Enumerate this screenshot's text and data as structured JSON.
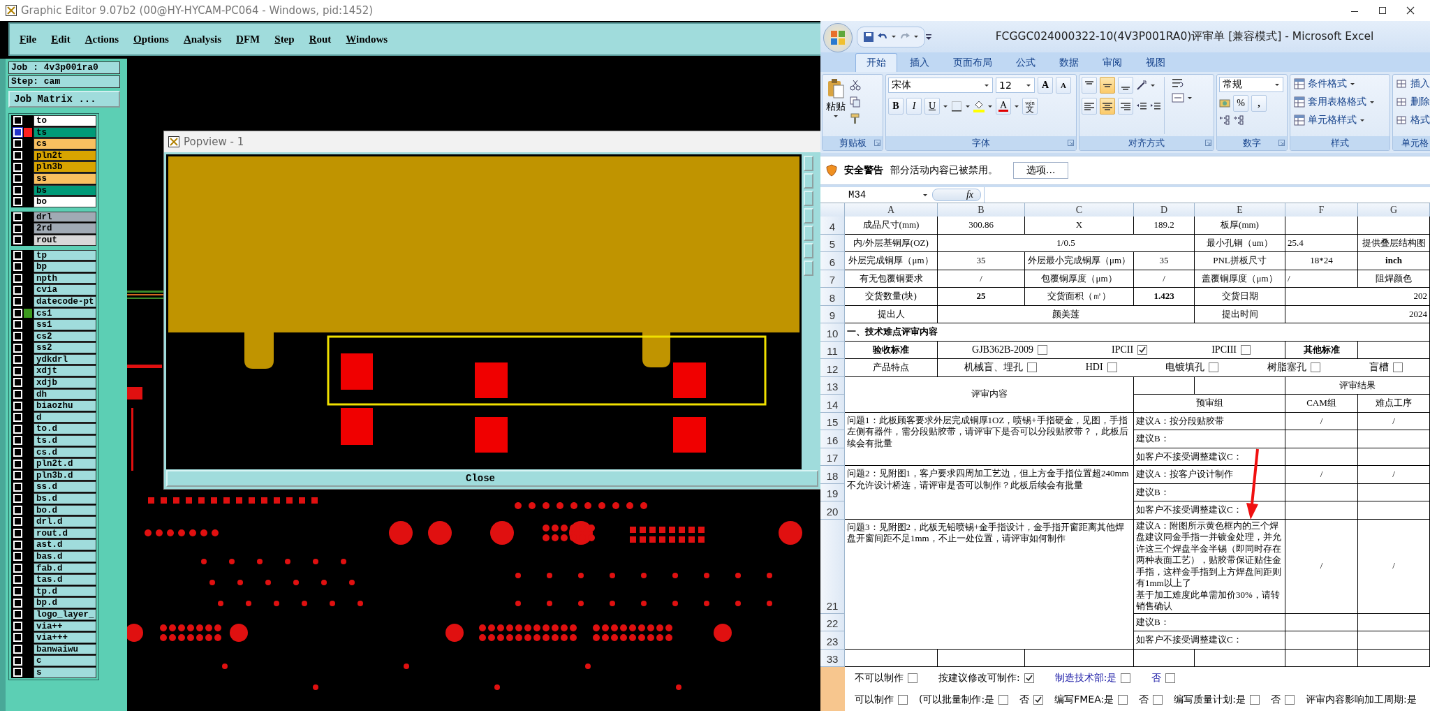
{
  "editor": {
    "title": "Graphic Editor 9.07b2 (00@HY-HYCAM-PC064 - Windows, pid:1452)",
    "menu": [
      "File",
      "Edit",
      "Actions",
      "Options",
      "Analysis",
      "DFM",
      "Step",
      "Rout",
      "Windows"
    ],
    "job": "Job : 4v3p001ra0",
    "step": "Step: cam",
    "job_matrix_button": "Job Matrix ...",
    "layer_groups": [
      [
        {
          "name": "to",
          "color": "#ffffff",
          "selected": false
        },
        {
          "name": "ts",
          "color": "#009a78",
          "selected": true,
          "marker": {
            "color": "#ff2020"
          }
        },
        {
          "name": "cs",
          "color": "#f8c060",
          "selected": false
        },
        {
          "name": "pln2t",
          "color": "#d8a400",
          "selected": false
        },
        {
          "name": "pln3b",
          "color": "#d8a400",
          "selected": false
        },
        {
          "name": "ss",
          "color": "#f8c060",
          "selected": false
        },
        {
          "name": "bs",
          "color": "#009a78",
          "selected": false
        },
        {
          "name": "bo",
          "color": "#ffffff",
          "selected": false
        }
      ],
      [
        {
          "name": "drl",
          "color": "#a0aab4",
          "selected": false
        },
        {
          "name": "2rd",
          "color": "#a0aab4",
          "selected": false
        },
        {
          "name": "rout",
          "color": "#d8d8d8",
          "selected": false
        }
      ],
      [
        {
          "name": "tp",
          "color": "#a0dcdc",
          "selected": false
        },
        {
          "name": "bp",
          "color": "#a0dcdc",
          "selected": false
        },
        {
          "name": "npth",
          "color": "#a0dcdc",
          "selected": false
        },
        {
          "name": "cvia",
          "color": "#a0dcdc",
          "selected": false
        },
        {
          "name": "datecode-pt",
          "color": "#a0dcdc",
          "selected": false
        },
        {
          "name": "cs1",
          "color": "#a0dcdc",
          "selected": false,
          "marker": {
            "color": "#3c9a1e"
          }
        },
        {
          "name": "ss1",
          "color": "#a0dcdc",
          "selected": false
        },
        {
          "name": "cs2",
          "color": "#a0dcdc",
          "selected": false
        },
        {
          "name": "ss2",
          "color": "#a0dcdc",
          "selected": false
        },
        {
          "name": "ydkdrl",
          "color": "#a0dcdc",
          "selected": false
        },
        {
          "name": "xdjt",
          "color": "#a0dcdc",
          "selected": false
        },
        {
          "name": "xdjb",
          "color": "#a0dcdc",
          "selected": false
        },
        {
          "name": "dh",
          "color": "#a0dcdc",
          "selected": false
        },
        {
          "name": "biaozhu",
          "color": "#a0dcdc",
          "selected": false
        },
        {
          "name": "d",
          "color": "#a0dcdc",
          "selected": false
        },
        {
          "name": "to.d",
          "color": "#a0dcdc",
          "selected": false
        },
        {
          "name": "ts.d",
          "color": "#a0dcdc",
          "selected": false
        },
        {
          "name": "cs.d",
          "color": "#a0dcdc",
          "selected": false
        },
        {
          "name": "pln2t.d",
          "color": "#a0dcdc",
          "selected": false
        },
        {
          "name": "pln3b.d",
          "color": "#a0dcdc",
          "selected": false
        },
        {
          "name": "ss.d",
          "color": "#a0dcdc",
          "selected": false
        },
        {
          "name": "bs.d",
          "color": "#a0dcdc",
          "selected": false
        },
        {
          "name": "bo.d",
          "color": "#a0dcdc",
          "selected": false
        },
        {
          "name": "drl.d",
          "color": "#a0dcdc",
          "selected": false
        },
        {
          "name": "rout.d",
          "color": "#a0dcdc",
          "selected": false
        },
        {
          "name": "ast.d",
          "color": "#a0dcdc",
          "selected": false
        },
        {
          "name": "bas.d",
          "color": "#a0dcdc",
          "selected": false
        },
        {
          "name": "fab.d",
          "color": "#a0dcdc",
          "selected": false
        },
        {
          "name": "tas.d",
          "color": "#a0dcdc",
          "selected": false
        },
        {
          "name": "tp.d",
          "color": "#a0dcdc",
          "selected": false
        },
        {
          "name": "bp.d",
          "color": "#a0dcdc",
          "selected": false
        },
        {
          "name": "logo_layer_",
          "color": "#a0dcdc",
          "selected": false
        },
        {
          "name": "via++",
          "color": "#a0dcdc",
          "selected": false
        },
        {
          "name": "via+++",
          "color": "#a0dcdc",
          "selected": false
        },
        {
          "name": "banwaiwu",
          "color": "#a0dcdc",
          "selected": false
        },
        {
          "name": "c",
          "color": "#a0dcdc",
          "selected": false
        },
        {
          "name": "s",
          "color": "#a0dcdc",
          "selected": false
        }
      ]
    ],
    "popview": {
      "title": "Popview - 1",
      "close_button": "Close"
    }
  },
  "excel": {
    "title": "FCGGC024000322-10(4V3P001RA0)评审单  [兼容模式] - Microsoft Excel",
    "tabs": [
      {
        "label": "开始",
        "selected": true
      },
      {
        "label": "插入",
        "selected": false
      },
      {
        "label": "页面布局",
        "selected": false
      },
      {
        "label": "公式",
        "selected": false
      },
      {
        "label": "数据",
        "selected": false
      },
      {
        "label": "审阅",
        "selected": false
      },
      {
        "label": "视图",
        "selected": false
      }
    ],
    "ribbon": {
      "clipboard": {
        "paste": "粘贴",
        "label": "剪贴板"
      },
      "font": {
        "name": "宋体",
        "size": "12",
        "grow": "A",
        "shrink": "A",
        "bold": "B",
        "italic": "I",
        "underline": "U",
        "font_color": "A",
        "phonetic_top": "wén",
        "phonetic_bottom": "文",
        "label": "字体"
      },
      "alignment": {
        "label": "对齐方式",
        "vertical": [
          {
            "selected": false
          },
          {
            "selected": true
          },
          {
            "selected": false
          }
        ],
        "horizontal": [
          {
            "selected": false
          },
          {
            "selected": true
          },
          {
            "selected": false
          }
        ]
      },
      "number": {
        "format": "常规",
        "percent": "%",
        "comma": ",",
        "label": "数字"
      },
      "styles": {
        "items": [
          "条件格式",
          "套用表格格式",
          "单元格样式"
        ],
        "label": "样式"
      },
      "cells": {
        "items": [
          "插入",
          "删除",
          "格式"
        ],
        "label": "单元格"
      }
    },
    "security": {
      "title": "安全警告",
      "message": "部分活动内容已被禁用。",
      "button": "选项..."
    },
    "name_box": "M34",
    "formula_label": "fx",
    "columns": [
      "A",
      "B",
      "C",
      "D",
      "E",
      "F",
      "G"
    ],
    "row_numbers": [
      "4",
      "5",
      "6",
      "7",
      "8",
      "9",
      "10",
      "11",
      "12",
      "13",
      "14",
      "15",
      "16",
      "17",
      "18",
      "19",
      "20",
      "21",
      "22",
      "23",
      "33"
    ],
    "cells": [
      {
        "text": "成品尺寸(mm)"
      },
      {
        "text": "300.86"
      },
      {
        "text": "X"
      },
      {
        "text": "189.2"
      },
      {
        "text": "板厚(mm)"
      },
      {
        "text": "内/外层基铜厚(OZ)"
      },
      {
        "text": "1/0.5"
      },
      {
        "text": "最小孔铜（um）"
      },
      {
        "text": "25.4"
      },
      {
        "text": "提供叠层结构图"
      },
      {
        "text": "外层完成铜厚（μm）"
      },
      {
        "text": "35"
      },
      {
        "text": "外层最小完成铜厚（μm）"
      },
      {
        "text": "35"
      },
      {
        "text": "PNL拼板尺寸"
      },
      {
        "text": "18*24"
      },
      {
        "text": "inch",
        "bold": true
      },
      {
        "text": "有无包覆铜要求"
      },
      {
        "text": "/"
      },
      {
        "text": "包覆铜厚度（μm）"
      },
      {
        "text": "/"
      },
      {
        "text": "盖覆铜厚度（μm）"
      },
      {
        "text": "/"
      },
      {
        "text": "阻焊颜色"
      },
      {
        "text": "交货数量(块)"
      },
      {
        "text": "25",
        "bold": true
      },
      {
        "text": "交货面积（㎡）"
      },
      {
        "text": "1.423",
        "bold": true
      },
      {
        "text": "交货日期"
      },
      {
        "text": "202"
      },
      {
        "text": "提出人"
      },
      {
        "text": "颜美莲"
      },
      {
        "text": "提出时间"
      },
      {
        "text": "2024"
      },
      {
        "text": "一、技术难点评审内容",
        "bold": true
      },
      {
        "text": "验收标准",
        "bold": true
      },
      {
        "options": [
          {
            "label": "GJB362B-2009",
            "checked": false
          },
          {
            "label": "IPCII",
            "checked": true
          },
          {
            "label": "IPCIII",
            "checked": false
          }
        ]
      },
      {
        "text": "其他标准",
        "bold": true
      },
      {
        "text": "产品特点"
      },
      {
        "options": [
          {
            "label": "机械盲、埋孔",
            "checked": false
          },
          {
            "label": "HDI",
            "checked": false
          },
          {
            "label": "电镀填孔",
            "checked": false
          },
          {
            "label": "树脂塞孔",
            "checked": false
          },
          {
            "label": "盲槽",
            "checked": false
          }
        ]
      },
      {
        "text": "评审内容"
      },
      {
        "text": "评审结果"
      },
      {
        "text": "预审组"
      },
      {
        "text": "CAM组"
      },
      {
        "text": "难点工序"
      },
      {
        "text": "问题1：此板顾客要求外层完成铜厚1OZ，喷锡+手指硬金，见图，手指左侧有器件，需分段贴胶带，请评审下是否可以分段贴胶带？，此板后续会有批量"
      },
      {
        "text": "建议A：按分段贴胶带"
      },
      {
        "text": "/"
      },
      {
        "text": "/"
      },
      {
        "text": "建议B："
      },
      {
        "text": "如客户不接受调整建议C："
      },
      {
        "text": "问题2：见附图1，客户要求四周加工艺边，但上方金手指位置超240mm不允许设计桥连，请评审是否可以制作？此板后续会有批量"
      },
      {
        "text": "建议A：按客户设计制作"
      },
      {
        "text": "/"
      },
      {
        "text": "/"
      },
      {
        "text": "建议B："
      },
      {
        "text": "如客户不接受调整建议C："
      },
      {
        "text": "问题3：见附图2，此板无铅喷锡+金手指设计，金手指开窗距离其他焊盘开窗间距不足1mm，不止一处位置，请评审如何制作"
      },
      {
        "paragraphs": [
          "建议A：附图所示黄色框内的三个焊盘建议同金手指一并镀金处理，并允许这三个焊盘半金半锡（即同时存在两种表面工艺），贴胶带保证贴住金手指，这样金手指到上方焊盘间距则有1mm以上了",
          "基于加工难度此单需加价30%，请转销售确认"
        ]
      },
      {
        "text": "/"
      },
      {
        "text": "/"
      },
      {
        "text": "建议B："
      },
      {
        "text": "如客户不接受调整建议C："
      }
    ],
    "footer": [
      [
        {
          "kind": "checkbox",
          "label": "不可以制作",
          "checked": false,
          "highlighted": false
        },
        {
          "kind": "checkbox",
          "label": "按建议修改可制作:",
          "checked": true,
          "highlighted": false
        },
        {
          "kind": "checkbox",
          "label": "制造技术部:是",
          "checked": false,
          "highlighted": true
        },
        {
          "kind": "checkbox",
          "label": "否",
          "checked": false,
          "highlighted": true
        }
      ],
      [
        {
          "kind": "checkbox",
          "label": "可以制作",
          "checked": false,
          "highlighted": false
        },
        {
          "kind": "checkbox",
          "label": "(可以批量制作:是",
          "checked": false,
          "highlighted": false
        },
        {
          "kind": "checkbox",
          "label": "否",
          "checked": true,
          "highlighted": false
        },
        {
          "kind": "checkbox",
          "label": "编写FMEA:是",
          "checked": false,
          "highlighted": false
        },
        {
          "kind": "checkbox",
          "label": "否",
          "checked": false,
          "highlighted": false
        },
        {
          "kind": "checkbox",
          "label": "编写质量计划:是",
          "checked": false,
          "highlighted": false
        },
        {
          "kind": "checkbox",
          "label": "否",
          "checked": false,
          "highlighted": false
        },
        {
          "kind": "text",
          "label": "评审内容影响加工周期:是",
          "highlighted": false
        }
      ]
    ]
  }
}
